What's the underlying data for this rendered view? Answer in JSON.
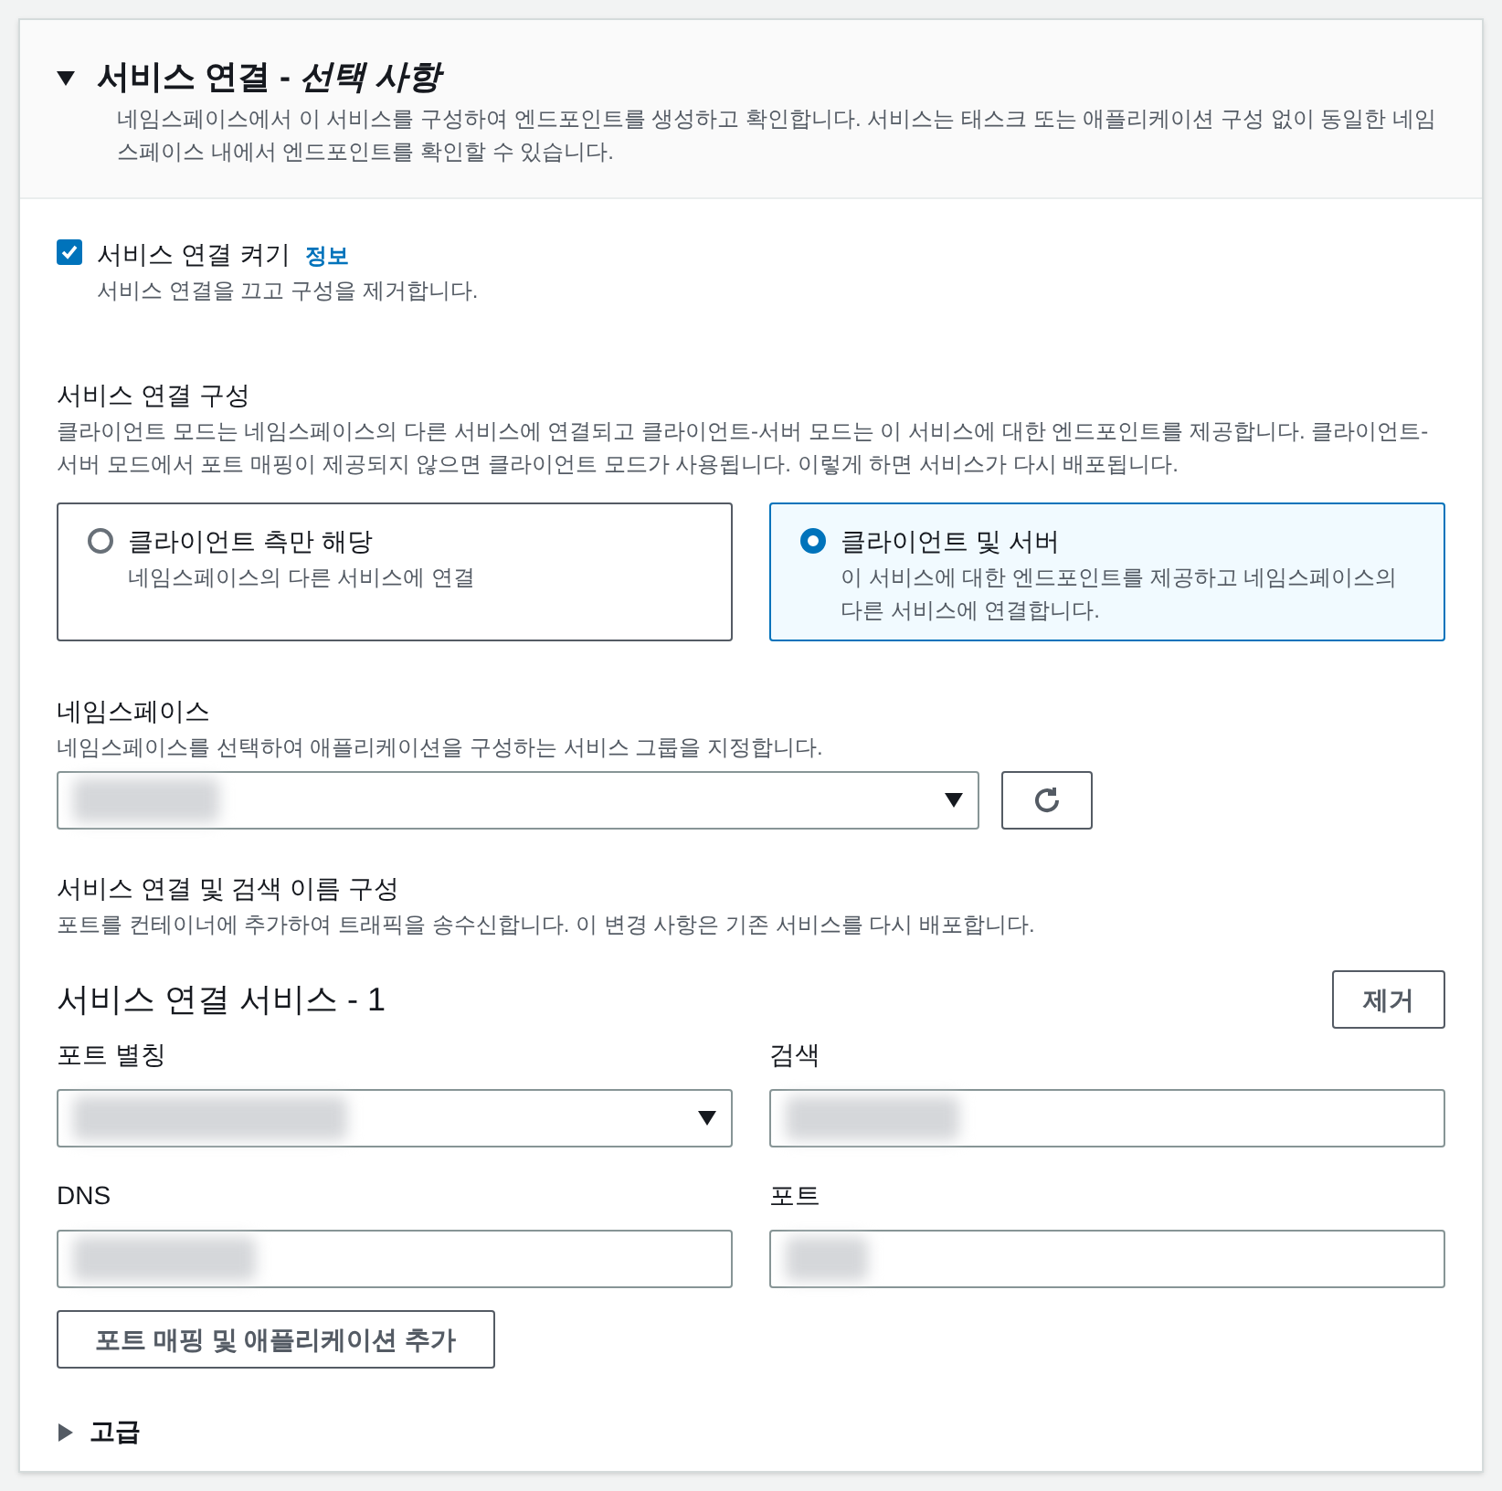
{
  "header": {
    "expanded": true,
    "title": "서비스 연결 - ",
    "title_italic": "선택 사항",
    "description": "네임스페이스에서 이 서비스를 구성하여 엔드포인트를 생성하고 확인합니다. 서비스는 태스크 또는 애플리케이션 구성 없이 동일한 네임스페이스 내에서 엔드포인트를 확인할 수 있습니다."
  },
  "toggle": {
    "label": "서비스 연결 켜기",
    "checked": true,
    "info": "정보",
    "description": "서비스 연결을 끄고 구성을 제거합니다."
  },
  "config": {
    "label": "서비스 연결 구성",
    "description": "클라이언트 모드는 네임스페이스의 다른 서비스에 연결되고 클라이언트-서버 모드는 이 서비스에 대한 엔드포인트를 제공합니다. 클라이언트-서버 모드에서 포트 매핑이 제공되지 않으면 클라이언트 모드가 사용됩니다. 이렇게 하면 서비스가 다시 배포됩니다.",
    "options": [
      {
        "label": "클라이언트 측만 해당",
        "description": "네임스페이스의 다른 서비스에 연결",
        "selected": false
      },
      {
        "label": "클라이언트 및 서버",
        "description": "이 서비스에 대한 엔드포인트를 제공하고 네임스페이스의 다른 서비스에 연결합니다.",
        "selected": true
      }
    ]
  },
  "namespace": {
    "label": "네임스페이스",
    "description": "네임스페이스를 선택하여 애플리케이션을 구성하는 서비스 그룹을 지정합니다."
  },
  "discovery": {
    "label": "서비스 연결 및 검색 이름 구성",
    "description": "포트를 컨테이너에 추가하여 트래픽을 송수신합니다. 이 변경 사항은 기존 서비스를 다시 배포합니다."
  },
  "service": {
    "title": "서비스 연결 서비스 - 1",
    "remove_button": "제거",
    "fields": [
      {
        "label": "포트 별칭",
        "kind": "select"
      },
      {
        "label": "검색",
        "kind": "text"
      },
      {
        "label": "DNS",
        "kind": "text"
      },
      {
        "label": "포트",
        "kind": "text"
      }
    ]
  },
  "add_button": "포트 매핑 및 애플리케이션 추가",
  "advanced": {
    "label": "고급",
    "expanded": false
  }
}
